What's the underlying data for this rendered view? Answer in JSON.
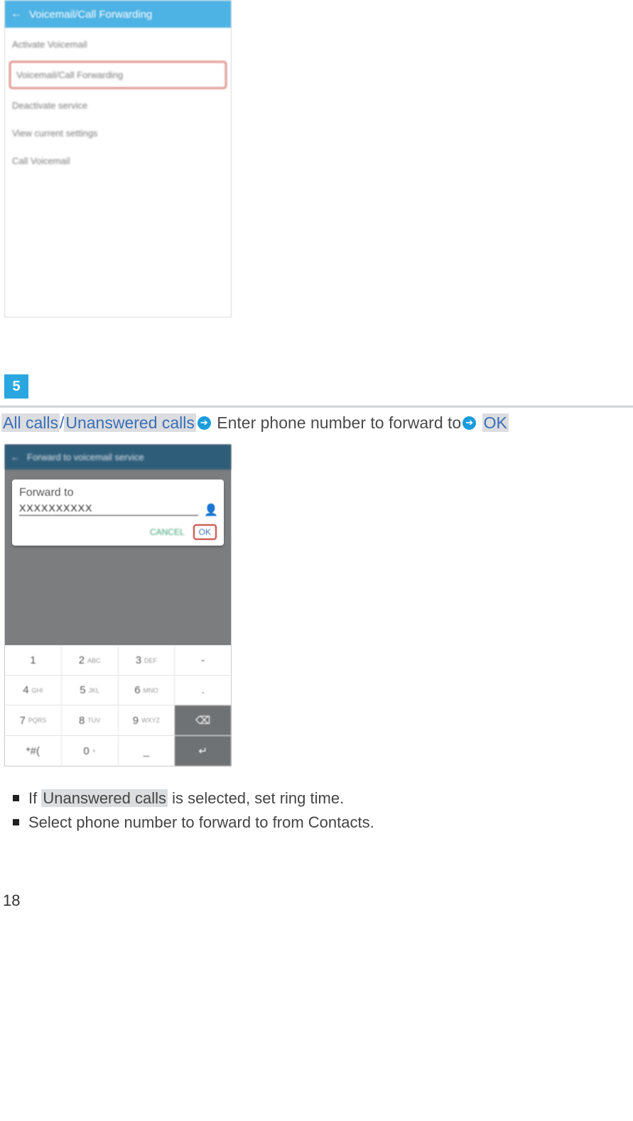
{
  "screenshot1": {
    "header_title": "Voicemail/Call Forwarding",
    "items": [
      "Activate Voicemail",
      "Voicemail/Call Forwarding",
      "Deactivate service",
      "View current settings",
      "Call Voicemail"
    ],
    "highlight_index": 1
  },
  "step_number": "5",
  "instruction": {
    "opt1": "All calls",
    "slash": "/",
    "opt2": "Unanswered calls",
    "action_text": " Enter phone number to forward to",
    "ok_text": "OK"
  },
  "screenshot2": {
    "header_title": "Forward to voicemail service",
    "card_label": "Forward to",
    "card_number": "XXXXXXXXXX",
    "cancel": "CANCEL",
    "ok": "OK",
    "dialpad": [
      [
        {
          "d": "1",
          "s": ""
        },
        {
          "d": "2",
          "s": "ABC"
        },
        {
          "d": "3",
          "s": "DEF"
        },
        {
          "d": "-",
          "s": ""
        }
      ],
      [
        {
          "d": "4",
          "s": "GHI"
        },
        {
          "d": "5",
          "s": "JKL"
        },
        {
          "d": "6",
          "s": "MNO"
        },
        {
          "d": ".",
          "s": ""
        }
      ],
      [
        {
          "d": "7",
          "s": "PQRS"
        },
        {
          "d": "8",
          "s": "TUV"
        },
        {
          "d": "9",
          "s": "WXYZ"
        },
        {
          "d": "⌫",
          "s": "",
          "dark": true
        }
      ],
      [
        {
          "d": "*#(",
          "s": ""
        },
        {
          "d": "0",
          "s": "+"
        },
        {
          "d": "_",
          "s": ""
        },
        {
          "d": "↵",
          "s": "",
          "dark": true
        }
      ]
    ]
  },
  "notes": {
    "n1_pre": "If ",
    "n1_hl": "Unanswered calls",
    "n1_post": " is selected, set ring time.",
    "n2": "Select phone number to forward to from Contacts."
  },
  "page_number": "18"
}
